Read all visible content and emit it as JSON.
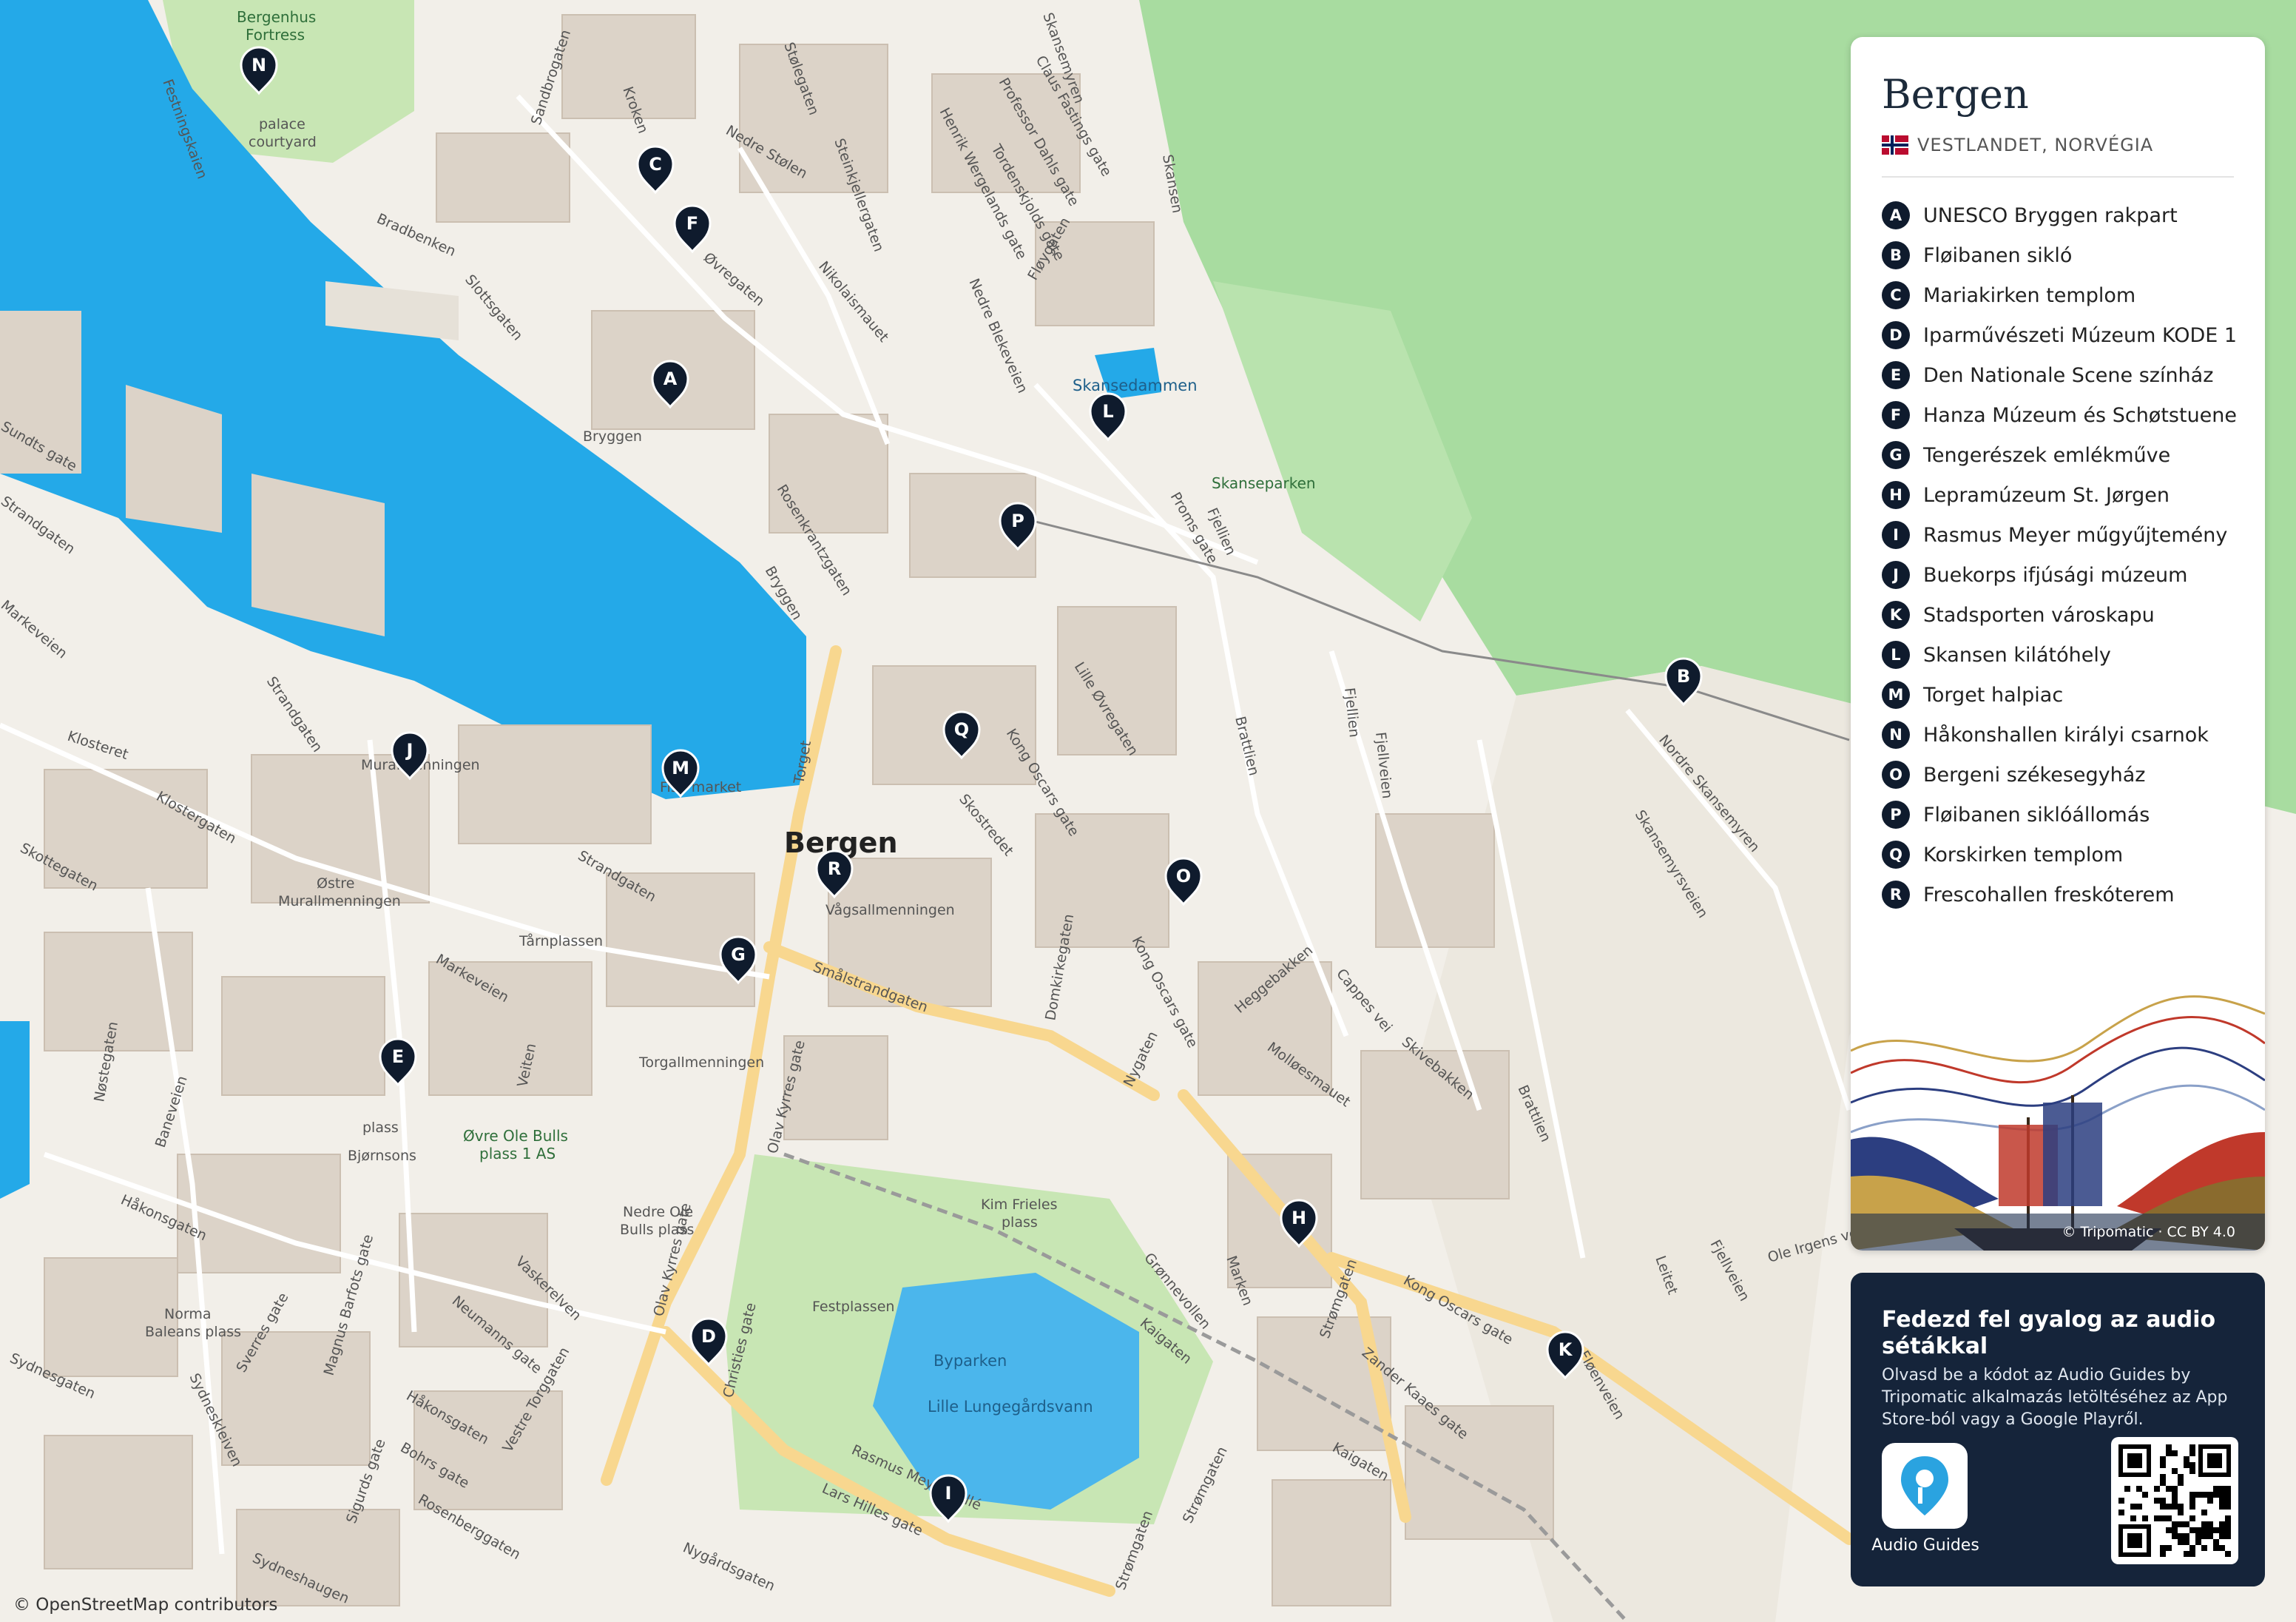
{
  "map": {
    "city_label": "Bergen",
    "attribution": "© OpenStreetMap contributors",
    "place_labels": [
      {
        "id": "fortress",
        "text": "Bergenhus"
      },
      {
        "id": "fortress2",
        "text": "Fortress"
      },
      {
        "id": "palace1",
        "text": "palace"
      },
      {
        "id": "palace2",
        "text": "courtyard"
      },
      {
        "id": "bryggen",
        "text": "Bryggen"
      },
      {
        "id": "skansedammen",
        "text": "Skansedammen"
      },
      {
        "id": "skanseparken",
        "text": "Skanseparken"
      },
      {
        "id": "muralmenningen",
        "text": "Muralmenningen"
      },
      {
        "id": "fishmarket",
        "text": "Fish market"
      },
      {
        "id": "ostre1",
        "text": "Østre"
      },
      {
        "id": "ostre2",
        "text": "Murallmenningen"
      },
      {
        "id": "vagsallmenningen",
        "text": "Vågsallmenningen"
      },
      {
        "id": "tarnplassen",
        "text": "Tårnplassen"
      },
      {
        "id": "torgallmenningen",
        "text": "Torgallmenningen"
      },
      {
        "id": "bjornsons1",
        "text": "Bjørnsons"
      },
      {
        "id": "bjornsons2",
        "text": "plass"
      },
      {
        "id": "ovreole1",
        "text": "Øvre Ole Bulls"
      },
      {
        "id": "ovreole2",
        "text": "plass 1 AS"
      },
      {
        "id": "nedreole1",
        "text": "Nedre Ole"
      },
      {
        "id": "nedreole2",
        "text": "Bulls plass"
      },
      {
        "id": "kimfrieles1",
        "text": "Kim Frieles"
      },
      {
        "id": "kimfrieles2",
        "text": "plass"
      },
      {
        "id": "festplassen",
        "text": "Festplassen"
      },
      {
        "id": "byparken",
        "text": "Byparken"
      },
      {
        "id": "lungegard",
        "text": "Lille Lungegårdsvann"
      },
      {
        "id": "norma1",
        "text": "Norma"
      },
      {
        "id": "norma2",
        "text": "Baleans plass"
      }
    ],
    "street_labels": [
      {
        "id": "s1",
        "text": "Festningskaien"
      },
      {
        "id": "s2",
        "text": "Bradbenken"
      },
      {
        "id": "s3",
        "text": "Slottsgaten"
      },
      {
        "id": "s4",
        "text": "Sandbrogaten"
      },
      {
        "id": "s5",
        "text": "Kroken"
      },
      {
        "id": "s6",
        "text": "Nedre Stølen"
      },
      {
        "id": "s7",
        "text": "Stølegaten"
      },
      {
        "id": "s8",
        "text": "Steinkjellergaten"
      },
      {
        "id": "s9",
        "text": "Øvregaten"
      },
      {
        "id": "s10",
        "text": "Nikolaismauet"
      },
      {
        "id": "s11",
        "text": "Nedre Blekeveien"
      },
      {
        "id": "s12",
        "text": "Tordenskjolds gate"
      },
      {
        "id": "s13",
        "text": "Professor Dahls gate"
      },
      {
        "id": "s14",
        "text": "Claus Fastings gate"
      },
      {
        "id": "s15",
        "text": "Henrik Wergelands gate"
      },
      {
        "id": "s16",
        "text": "Fløygaten"
      },
      {
        "id": "s17",
        "text": "Skansemyren"
      },
      {
        "id": "s18",
        "text": "Skansen"
      },
      {
        "id": "s19",
        "text": "Rosenkrantzgaten"
      },
      {
        "id": "s20",
        "text": "Bryggen"
      },
      {
        "id": "s21",
        "text": "Proms gate"
      },
      {
        "id": "s22",
        "text": "Fjellien"
      },
      {
        "id": "s23",
        "text": "Lille Øvregaten"
      },
      {
        "id": "s24",
        "text": "Kong Oscars gate"
      },
      {
        "id": "s25",
        "text": "Skostredet"
      },
      {
        "id": "s26",
        "text": "Torget"
      },
      {
        "id": "s27",
        "text": "Strandgaten"
      },
      {
        "id": "s28",
        "text": "Klosteret"
      },
      {
        "id": "s29",
        "text": "Klostergaten"
      },
      {
        "id": "s30",
        "text": "Skottegaten"
      },
      {
        "id": "s31",
        "text": "Markeveien"
      },
      {
        "id": "s32",
        "text": "Strandgaten"
      },
      {
        "id": "s33",
        "text": "Smålstrandgaten"
      },
      {
        "id": "s34",
        "text": "Domkirkegaten"
      },
      {
        "id": "s35",
        "text": "Kong Oscars gate"
      },
      {
        "id": "s36",
        "text": "Heggebakken"
      },
      {
        "id": "s37",
        "text": "Cappes vei"
      },
      {
        "id": "s38",
        "text": "Skivebakken"
      },
      {
        "id": "s39",
        "text": "Nygaten"
      },
      {
        "id": "s40",
        "text": "Molløesmauet"
      },
      {
        "id": "s41",
        "text": "Brattlien"
      },
      {
        "id": "s42",
        "text": "Fjellien"
      },
      {
        "id": "s43",
        "text": "Fjellveien"
      },
      {
        "id": "s44",
        "text": "Nordre Skansemyren"
      },
      {
        "id": "s45",
        "text": "Skansemyrsveien"
      },
      {
        "id": "s46",
        "text": "Olav Kyrres gate"
      },
      {
        "id": "s47",
        "text": "Veiten"
      },
      {
        "id": "s48",
        "text": "Nøstegaten"
      },
      {
        "id": "s49",
        "text": "Baneveien"
      },
      {
        "id": "s50",
        "text": "Håkonsgaten"
      },
      {
        "id": "s51",
        "text": "Magnus Barfots gate"
      },
      {
        "id": "s52",
        "text": "Vaskerelven"
      },
      {
        "id": "s53",
        "text": "Neumanns gate"
      },
      {
        "id": "s54",
        "text": "Sverres gate"
      },
      {
        "id": "s55",
        "text": "Sydnesgaten"
      },
      {
        "id": "s56",
        "text": "Sydneskleiven"
      },
      {
        "id": "s57",
        "text": "Håkonsgaten"
      },
      {
        "id": "s58",
        "text": "Vestre Torggaten"
      },
      {
        "id": "s59",
        "text": "Bohrs gate"
      },
      {
        "id": "s60",
        "text": "Sigurds gate"
      },
      {
        "id": "s61",
        "text": "Rosenberggaten"
      },
      {
        "id": "s62",
        "text": "Olav Kyrres gate"
      },
      {
        "id": "s63",
        "text": "Christies gate"
      },
      {
        "id": "s64",
        "text": "Rasmus Meyers allé"
      },
      {
        "id": "s65",
        "text": "Lars Hilles gate"
      },
      {
        "id": "s66",
        "text": "Nygårdsgaten"
      },
      {
        "id": "s67",
        "text": "Grønnevollen"
      },
      {
        "id": "s68",
        "text": "Kaigaten"
      },
      {
        "id": "s69",
        "text": "Marken"
      },
      {
        "id": "s70",
        "text": "Strømgaten"
      },
      {
        "id": "s71",
        "text": "Strømgaten"
      },
      {
        "id": "s72",
        "text": "Zander Kaaes gate"
      },
      {
        "id": "s73",
        "text": "Kong Oscars gate"
      },
      {
        "id": "s74",
        "text": "Kaigaten"
      },
      {
        "id": "s75",
        "text": "Brattlien"
      },
      {
        "id": "s76",
        "text": "Leitet"
      },
      {
        "id": "s77",
        "text": "Fjellveien"
      },
      {
        "id": "s78",
        "text": "Ole Irgens vei"
      },
      {
        "id": "s79",
        "text": "Strømgaten"
      },
      {
        "id": "s80",
        "text": "Sundts gate"
      },
      {
        "id": "s81",
        "text": "Strandgaten"
      },
      {
        "id": "s82",
        "text": "Markeveien"
      },
      {
        "id": "s83",
        "text": "Fløenveien"
      },
      {
        "id": "s84",
        "text": "Sydneshaugen"
      }
    ],
    "markers": [
      {
        "letter": "A"
      },
      {
        "letter": "B"
      },
      {
        "letter": "C"
      },
      {
        "letter": "D"
      },
      {
        "letter": "E"
      },
      {
        "letter": "F"
      },
      {
        "letter": "G"
      },
      {
        "letter": "H"
      },
      {
        "letter": "I"
      },
      {
        "letter": "J"
      },
      {
        "letter": "K"
      },
      {
        "letter": "L"
      },
      {
        "letter": "M"
      },
      {
        "letter": "N"
      },
      {
        "letter": "O"
      },
      {
        "letter": "P"
      },
      {
        "letter": "Q"
      },
      {
        "letter": "R"
      }
    ],
    "colors": {
      "water": "#24a9e8",
      "park": "#c8e6b4",
      "forest": "#a8dca0",
      "land": "#f2efe9",
      "building": "#dcd3c8",
      "road_major": "#f8d78f",
      "marker": "#0f1b2d"
    }
  },
  "legend": {
    "title": "Bergen",
    "region": "VESTLANDET, NORVÉGIA",
    "items": [
      {
        "letter": "A",
        "label": "UNESCO Bryggen rakpart"
      },
      {
        "letter": "B",
        "label": "Fløibanen sikló"
      },
      {
        "letter": "C",
        "label": "Mariakirken templom"
      },
      {
        "letter": "D",
        "label": "Iparművészeti Múzeum KODE 1"
      },
      {
        "letter": "E",
        "label": "Den Nationale Scene színház"
      },
      {
        "letter": "F",
        "label": "Hanza Múzeum és Schøtstuene"
      },
      {
        "letter": "G",
        "label": "Tengerészek emlékműve"
      },
      {
        "letter": "H",
        "label": "Lepramúzeum St. Jørgen"
      },
      {
        "letter": "I",
        "label": "Rasmus Meyer műgyűjtemény"
      },
      {
        "letter": "J",
        "label": "Buekorps ifjúsági múzeum"
      },
      {
        "letter": "K",
        "label": "Stadsporten városkapu"
      },
      {
        "letter": "L",
        "label": "Skansen kilátóhely"
      },
      {
        "letter": "M",
        "label": "Torget halpiac"
      },
      {
        "letter": "N",
        "label": "Håkonshallen királyi csarnok"
      },
      {
        "letter": "O",
        "label": "Bergeni székesegyház"
      },
      {
        "letter": "P",
        "label": "Fløibanen siklóállomás"
      },
      {
        "letter": "Q",
        "label": "Korskirken templom"
      },
      {
        "letter": "R",
        "label": "Frescohallen freskóterem"
      }
    ],
    "credit": "© Tripomatic · CC BY 4.0"
  },
  "audio": {
    "heading": "Fedezd fel gyalog az audio sétákkal",
    "text": "Olvasd be a kódot az Audio Guides by Tripomatic alkalmazás letöltéséhez az App Store-ból vagy a Google Playről.",
    "app_label": "Audio Guides"
  }
}
